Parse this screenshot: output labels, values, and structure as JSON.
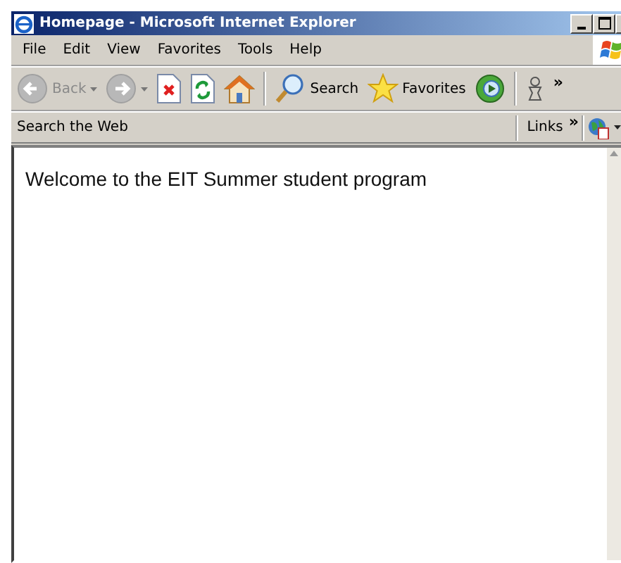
{
  "window": {
    "title": "Homepage - Microsoft Internet Explorer"
  },
  "menu": [
    "File",
    "Edit",
    "View",
    "Favorites",
    "Tools",
    "Help"
  ],
  "toolbar": [
    {
      "kind": "back",
      "label": "Back",
      "disabled": true
    },
    {
      "kind": "forward",
      "disabled": true
    },
    {
      "kind": "stop"
    },
    {
      "kind": "refresh"
    },
    {
      "kind": "home"
    },
    {
      "kind": "separator"
    },
    {
      "kind": "search",
      "label": "Search"
    },
    {
      "kind": "favorites",
      "label": "Favorites"
    },
    {
      "kind": "media"
    },
    {
      "kind": "separator"
    },
    {
      "kind": "messenger"
    },
    {
      "kind": "chevron",
      "label": "»"
    }
  ],
  "links_bar": {
    "search_label": "Search the Web",
    "links_label": "Links",
    "chevron": "»"
  },
  "page": {
    "text": "Welcome to the EIT Summer student program"
  }
}
